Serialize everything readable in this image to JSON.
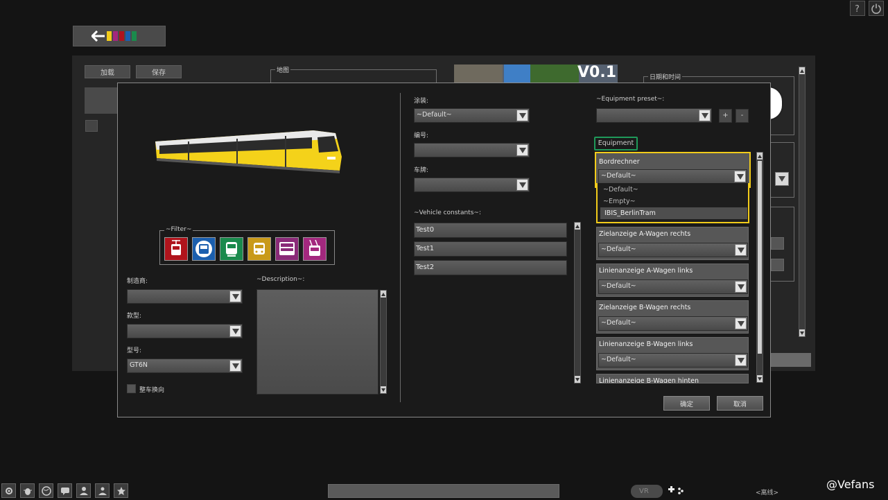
{
  "background": {
    "load_label": "加载",
    "save_label": "保存",
    "map_legend": "地图",
    "datetime_legend": "日期和时间",
    "version": "V0.1"
  },
  "modal": {
    "filter_legend": "~Filter~",
    "manufacturer_label": "制造商:",
    "model_label": "款型:",
    "type_label": "型号:",
    "type_value": "GT6N",
    "reverse_label": "整车换向",
    "description_legend": "~Description~:",
    "livery_label": "涂装:",
    "livery_value": "~Default~",
    "number_label": "编号:",
    "plate_label": "车牌:",
    "vehicle_constants_label": "~Vehicle constants~:",
    "constants": [
      "Test0",
      "Test1",
      "Test2"
    ],
    "equipment_preset_label": "~Equipment preset~:",
    "preset_add": "+",
    "preset_remove": "-",
    "equipment_tab": "Equipment",
    "bordrechner": {
      "title": "Bordrechner",
      "value": "~Default~",
      "options": [
        "~Default~",
        "~Empty~",
        "IBIS_BerlinTram"
      ]
    },
    "equipment": [
      {
        "title": "Zielanzeige A-Wagen rechts",
        "value": "~Default~"
      },
      {
        "title": "Linienanzeige A-Wagen links",
        "value": "~Default~"
      },
      {
        "title": "Zielanzeige B-Wagen rechts",
        "value": "~Default~"
      },
      {
        "title": "Linienanzeige B-Wagen links",
        "value": "~Default~"
      },
      {
        "title": "Linienanzeige B-Wagen hinten",
        "value": ""
      }
    ],
    "ok_label": "确定",
    "cancel_label": "取消"
  },
  "bottom": {
    "vr_label": "VR",
    "status_label": "<离线>",
    "watermark": "@Vefans"
  },
  "colors": {
    "accent_yellow": "#f2cc1a",
    "accent_green": "#1f9a5a",
    "filter_icons": [
      "#b0141c",
      "#1b5fae",
      "#1a8a4c",
      "#c99a1a",
      "#8a2a78",
      "#a3287e"
    ]
  },
  "icons": {
    "filter": [
      "tram-icon",
      "bus-icon",
      "train-icon",
      "tram-yellow-icon",
      "double-decker-icon",
      "trolleybus-icon"
    ]
  }
}
